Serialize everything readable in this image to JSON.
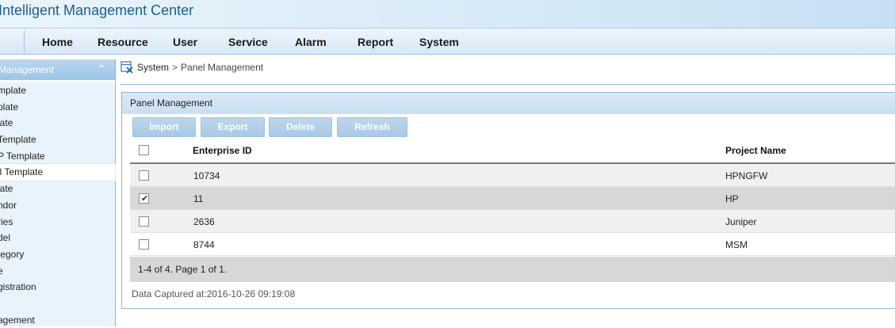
{
  "app": {
    "title": "Intelligent Management Center"
  },
  "nav": {
    "items": [
      "Home",
      "Resource",
      "User",
      "Service",
      "Alarm",
      "Report",
      "System"
    ]
  },
  "sidebar": {
    "header": "Management",
    "items": [
      "mplate",
      "plate",
      "late",
      " Template",
      "P Template",
      "ll Template",
      "late",
      "ndor",
      "ries",
      "del",
      "tegory",
      "e",
      "gistration",
      "",
      "agement"
    ]
  },
  "breadcrumb": {
    "root": "System",
    "separator": ">",
    "current": "Panel Management"
  },
  "panel": {
    "title": "Panel Management",
    "buttons": {
      "import": "Import",
      "export": "Export",
      "delete": "Delete",
      "refresh": "Refresh"
    },
    "columns": {
      "enterprise_id": "Enterprise ID",
      "project_name": "Project Name"
    },
    "rows": [
      {
        "enterprise_id": "10734",
        "project_name": "HPNGFW",
        "checked": false
      },
      {
        "enterprise_id": "11",
        "project_name": "HP",
        "checked": true
      },
      {
        "enterprise_id": "2636",
        "project_name": "Juniper",
        "checked": false
      },
      {
        "enterprise_id": "8744",
        "project_name": "MSM",
        "checked": false
      }
    ],
    "pager": "1-4 of 4. Page 1 of 1.",
    "captured": "Data Captured at:2016-10-26 09:19:08"
  },
  "colors": {
    "accent": "#1a5f98",
    "nav_bg": "#d6e7f5",
    "sidebar_header": "#9cc5e9",
    "selected_row": "#d7d7d7"
  }
}
